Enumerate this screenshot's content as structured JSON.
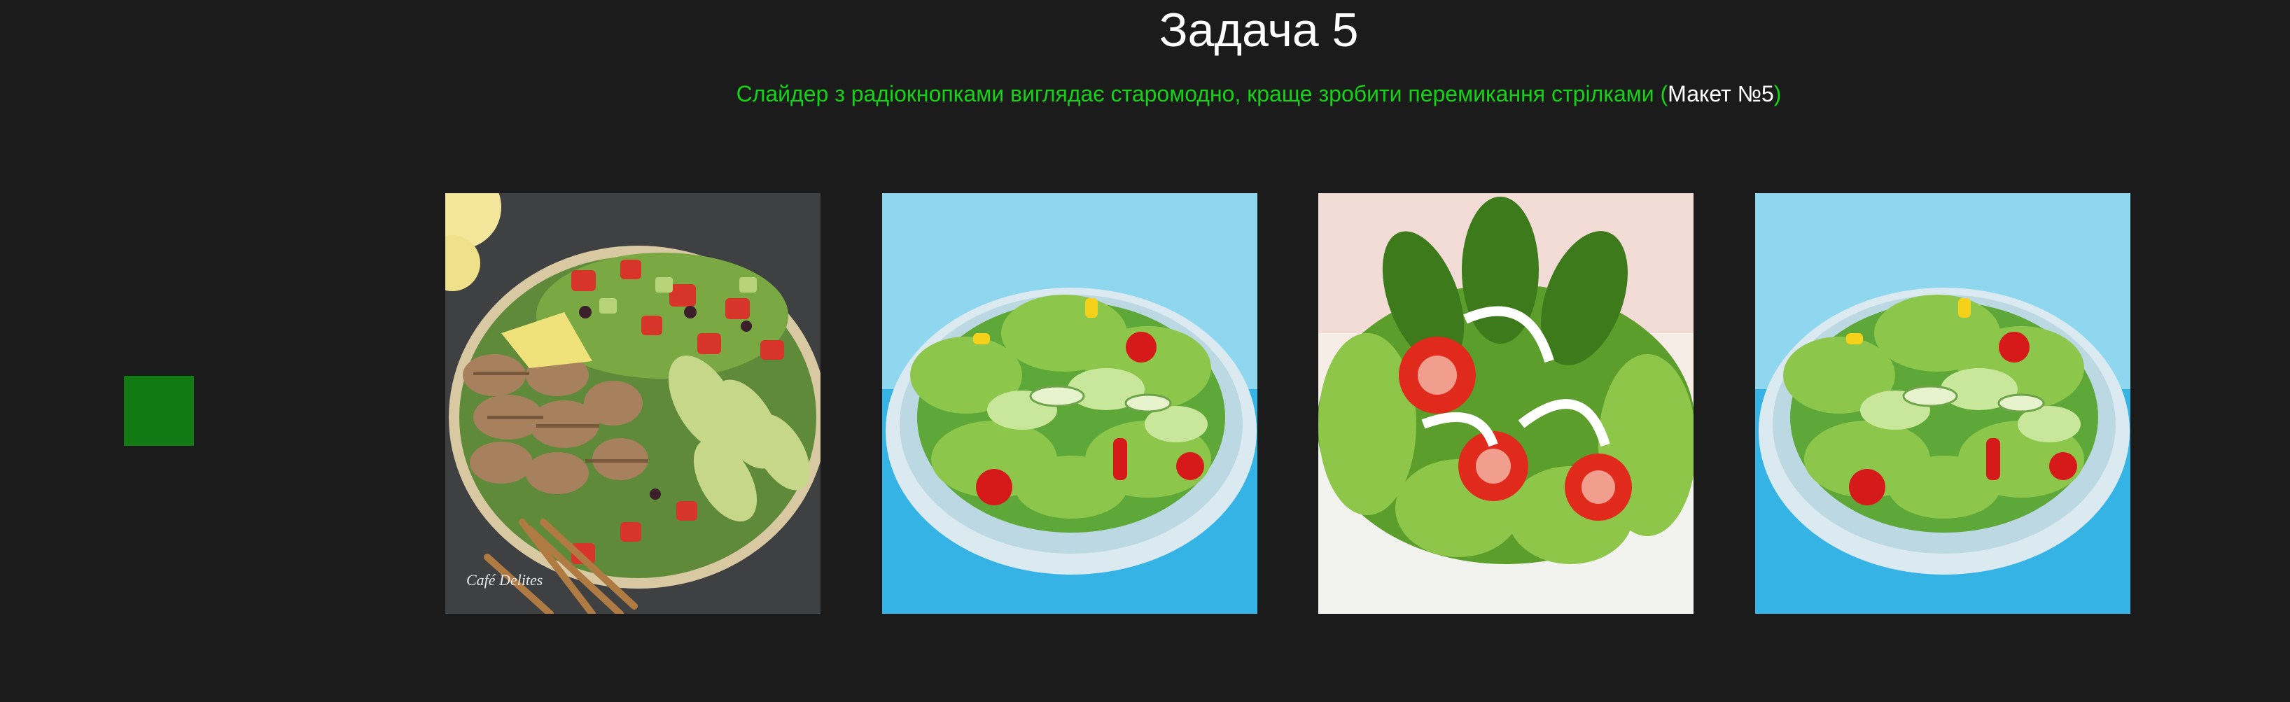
{
  "title": "Задача 5",
  "subtitle": {
    "text_before": "Слайдер з радіокнопками виглядає старомодно, краще зробити перемикання стрілками (",
    "reference": "Макет №5",
    "text_after": ")"
  },
  "colors": {
    "background": "#1b1b1b",
    "subtitle_green": "#14d314",
    "control_green": "#127a12"
  },
  "slider": {
    "control_icon": "green-square-icon",
    "slides": [
      {
        "name": "grilled-chicken-avocado-salad-photo",
        "watermark": "Café Delites"
      },
      {
        "name": "green-salad-bowl-photo"
      },
      {
        "name": "lettuce-tomato-onion-salad-photo"
      },
      {
        "name": "green-salad-bowl-photo"
      }
    ]
  }
}
